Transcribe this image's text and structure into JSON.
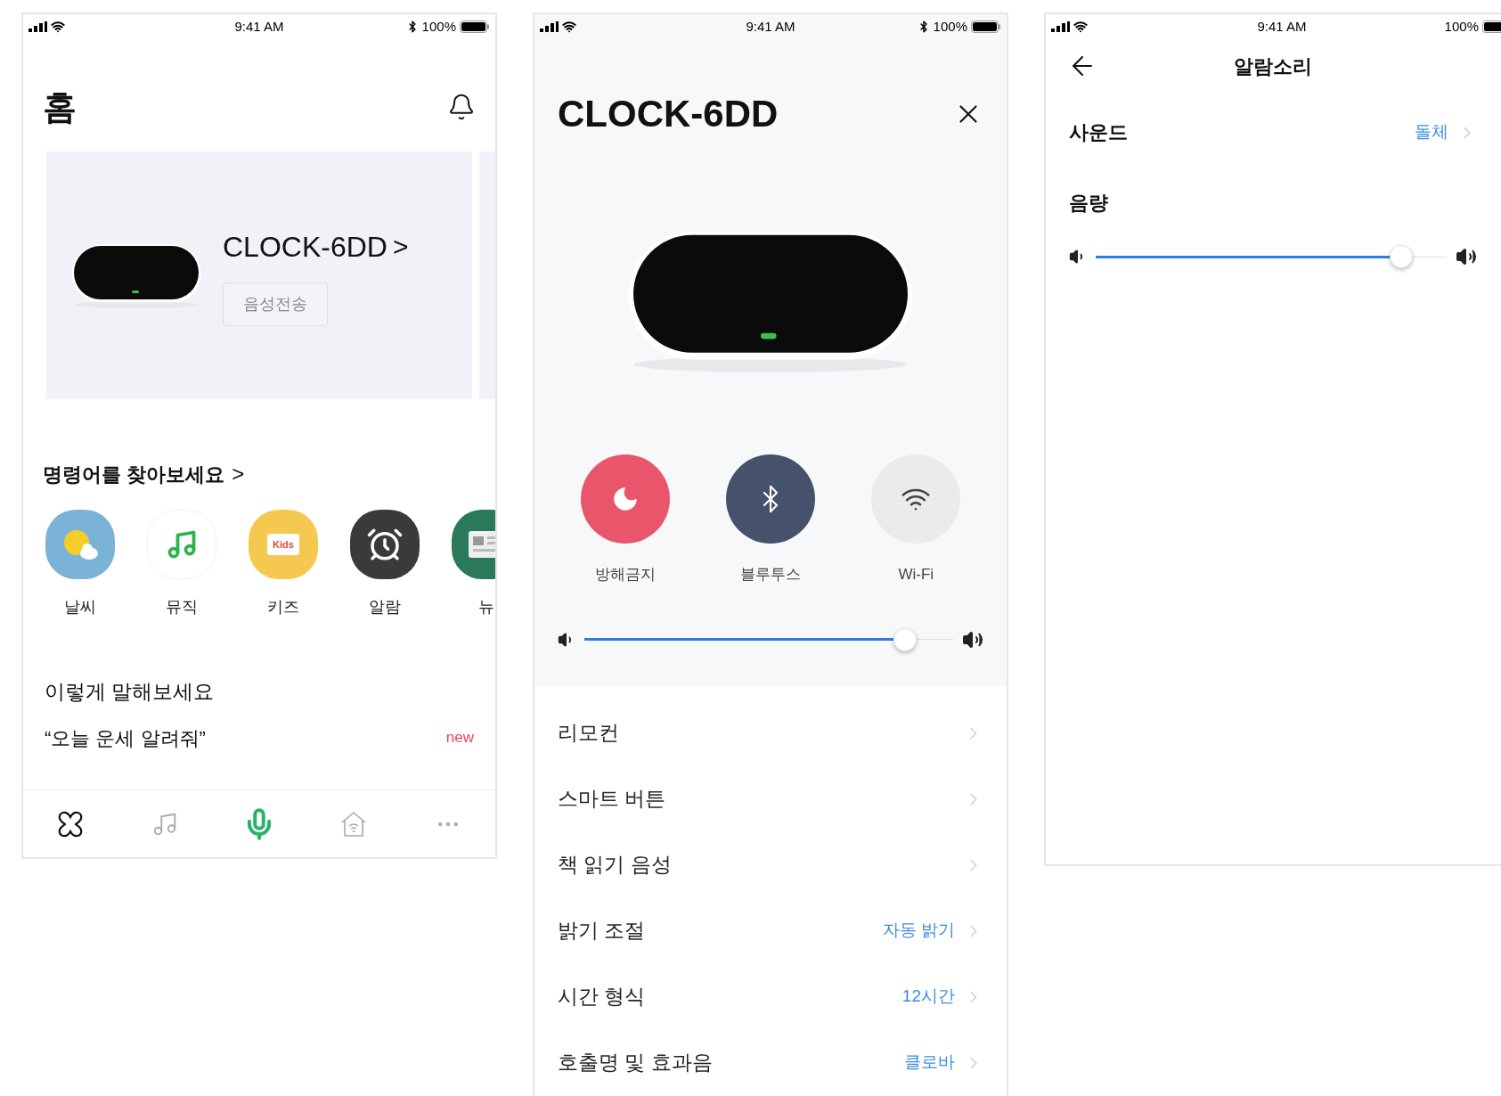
{
  "screens": [
    {
      "kind": "home",
      "status_bar": {
        "time": "9:41 AM",
        "battery": "100%",
        "bluetooth": true
      },
      "title": "홈",
      "device_card": {
        "name": "CLOCK-6DD",
        "arrow": ">",
        "button": "음성전송"
      },
      "commands": {
        "title": "명령어를 찾아보세요",
        "arrow": ">",
        "items": [
          {
            "kind": "weather",
            "label": "날씨"
          },
          {
            "kind": "music",
            "label": "뮤직"
          },
          {
            "kind": "kids",
            "label": "키즈",
            "badge": "Kids"
          },
          {
            "kind": "alarm",
            "label": "알람"
          },
          {
            "kind": "news",
            "label": "뉴"
          }
        ]
      },
      "suggestions": {
        "title": "이렇게 말해보세요",
        "items": [
          {
            "text": "“오늘 운세 알려줘”",
            "badge": "new"
          }
        ]
      },
      "tab_bar": [
        {
          "kind": "flower",
          "selected": false
        },
        {
          "kind": "music",
          "selected": false
        },
        {
          "kind": "mic",
          "selected": true
        },
        {
          "kind": "home",
          "selected": false
        },
        {
          "kind": "more",
          "selected": false
        }
      ]
    },
    {
      "kind": "device",
      "status_bar": {
        "time": "9:41 AM",
        "battery": "100%",
        "bluetooth": true
      },
      "title": "CLOCK-6DD",
      "toggles": [
        {
          "kind": "dnd",
          "label": "방해금지",
          "on": true
        },
        {
          "kind": "bluetooth",
          "label": "블루투스",
          "on": true
        },
        {
          "kind": "wifi",
          "label": "Wi-Fi",
          "on": false
        }
      ],
      "volume": {
        "level": 0.87
      },
      "settings": [
        {
          "label": "리모컨"
        },
        {
          "label": "스마트 버튼"
        },
        {
          "label": "책 읽기 음성"
        },
        {
          "label": "밝기 조절",
          "value": "자동 밝기"
        },
        {
          "label": "시간 형식",
          "value": "12시간"
        },
        {
          "label": "호출명 및 효과음",
          "value": "클로바"
        }
      ]
    },
    {
      "kind": "alarm_sound",
      "status_bar": {
        "time": "9:41 AM",
        "battery": "100%",
        "bluetooth": false
      },
      "title": "알람소리",
      "sound": {
        "label": "사운드",
        "value": "돌체"
      },
      "volume": {
        "label": "음량",
        "level": 0.87
      }
    }
  ]
}
